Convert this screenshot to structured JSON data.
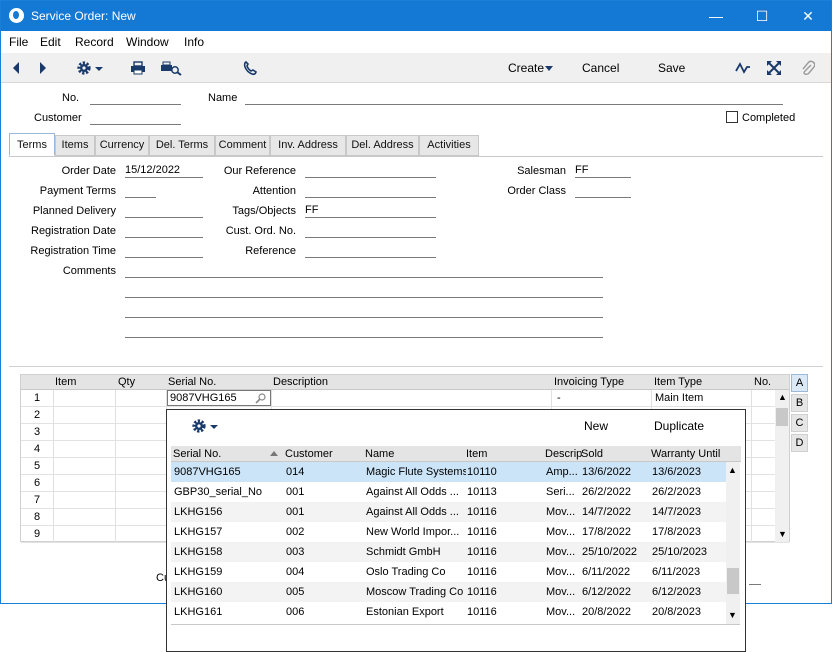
{
  "window": {
    "title": "Service Order: New",
    "minimize": "—",
    "maximize": "☐",
    "close": "✕"
  },
  "menu": [
    "File",
    "Edit",
    "Record",
    "Window",
    "Info"
  ],
  "toolbar": {
    "create": "Create",
    "cancel": "Cancel",
    "save": "Save"
  },
  "header": {
    "no_label": "No.",
    "no_value": "",
    "name_label": "Name",
    "name_value": "",
    "customer_label": "Customer",
    "customer_value": "",
    "completed_label": "Completed",
    "completed_checked": false
  },
  "tabs": [
    "Terms",
    "Items",
    "Currency",
    "Del. Terms",
    "Comment",
    "Inv. Address",
    "Del. Address",
    "Activities"
  ],
  "active_tab": "Terms",
  "terms": {
    "order_date_label": "Order Date",
    "order_date": "15/12/2022",
    "payment_terms_label": "Payment Terms",
    "payment_terms": "",
    "planned_delivery_label": "Planned Delivery",
    "planned_delivery": "",
    "registration_date_label": "Registration Date",
    "registration_date": "",
    "registration_time_label": "Registration Time",
    "registration_time": "",
    "comments_label": "Comments",
    "our_reference_label": "Our Reference",
    "our_reference": "",
    "attention_label": "Attention",
    "attention": "",
    "tags_label": "Tags/Objects",
    "tags": "FF",
    "cust_ord_label": "Cust. Ord. No.",
    "cust_ord": "",
    "reference_label": "Reference",
    "reference": "",
    "salesman_label": "Salesman",
    "salesman": "FF",
    "order_class_label": "Order Class",
    "order_class": ""
  },
  "grid": {
    "columns": [
      "Item",
      "Qty",
      "Serial No.",
      "Description",
      "Invoicing Type",
      "Item Type",
      "No."
    ],
    "row_numbers": [
      "1",
      "2",
      "3",
      "4",
      "5",
      "6",
      "7",
      "8",
      "9"
    ],
    "row1": {
      "serial": "9087VHG165",
      "invoicing_type": "-",
      "item_type": "Main Item"
    },
    "side_buttons": [
      "A",
      "B",
      "C",
      "D"
    ],
    "footer_partial": "Cu"
  },
  "popup": {
    "new_label": "New",
    "duplicate_label": "Duplicate",
    "columns": [
      "Serial No.",
      "Customer",
      "Name",
      "Item",
      "Descrip",
      "Sold",
      "Warranty Until"
    ],
    "rows": [
      {
        "serial": "9087VHG165",
        "customer": "014",
        "name": "Magic Flute Systems",
        "item": "10110",
        "desc": "Amp...",
        "sold": "13/6/2022",
        "warranty": "13/6/2023"
      },
      {
        "serial": "GBP30_serial_No",
        "customer": "001",
        "name": "Against All Odds ...",
        "item": "10113",
        "desc": "Seri...",
        "sold": "26/2/2022",
        "warranty": "26/2/2023"
      },
      {
        "serial": "LKHG156",
        "customer": "001",
        "name": "Against All Odds ...",
        "item": "10116",
        "desc": "Mov...",
        "sold": "14/7/2022",
        "warranty": "14/7/2023"
      },
      {
        "serial": "LKHG157",
        "customer": "002",
        "name": "New World Impor...",
        "item": "10116",
        "desc": "Mov...",
        "sold": "17/8/2022",
        "warranty": "17/8/2023"
      },
      {
        "serial": "LKHG158",
        "customer": "003",
        "name": "Schmidt GmbH",
        "item": "10116",
        "desc": "Mov...",
        "sold": "25/10/2022",
        "warranty": "25/10/2023"
      },
      {
        "serial": "LKHG159",
        "customer": "004",
        "name": "Oslo Trading Co",
        "item": "10116",
        "desc": "Mov...",
        "sold": "6/11/2022",
        "warranty": "6/11/2023"
      },
      {
        "serial": "LKHG160",
        "customer": "005",
        "name": "Moscow Trading Co",
        "item": "10116",
        "desc": "Mov...",
        "sold": "6/12/2022",
        "warranty": "6/12/2023"
      },
      {
        "serial": "LKHG161",
        "customer": "006",
        "name": "Estonian Export",
        "item": "10116",
        "desc": "Mov...",
        "sold": "20/8/2022",
        "warranty": "20/8/2023"
      }
    ]
  }
}
